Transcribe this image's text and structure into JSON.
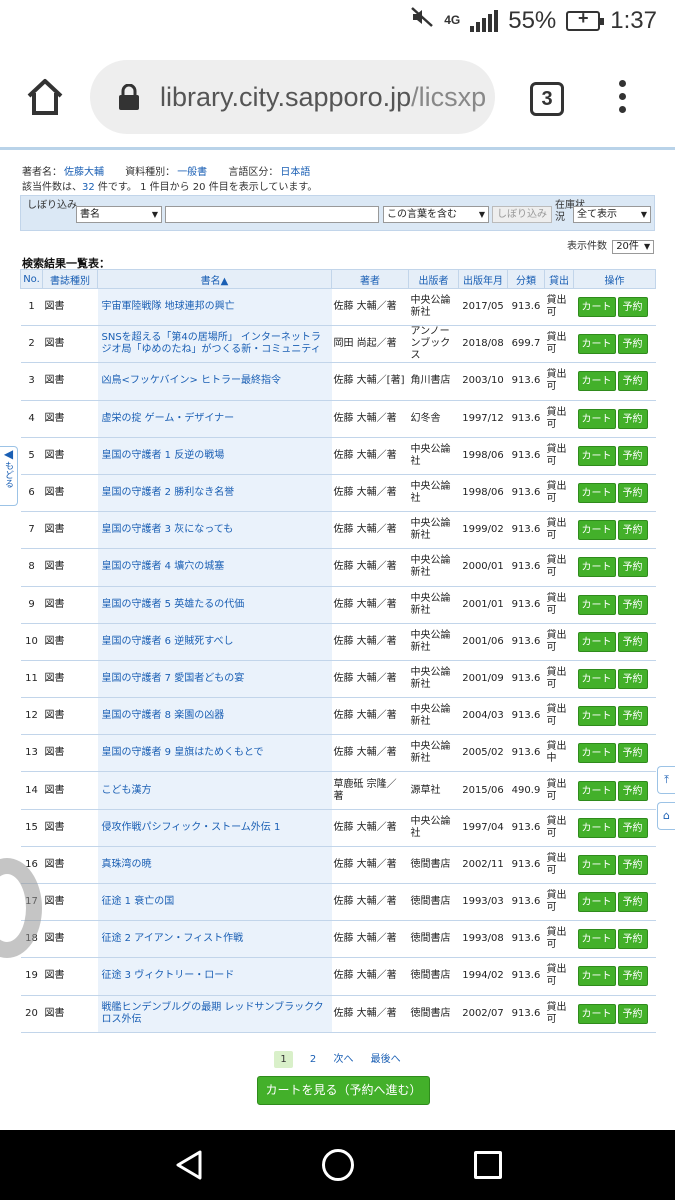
{
  "status_bar": {
    "network": "4G",
    "battery_percent": "55%",
    "time": "1:37"
  },
  "browser": {
    "url_main": "library.city.sapporo.jp",
    "url_rest": "/licsxp",
    "tab_count": "3"
  },
  "search_conditions": {
    "author_label": "著者名：",
    "author_value": "佐藤大輔",
    "type_label": "資料種別：",
    "type_value": "一般書",
    "lang_label": "言語区分：",
    "lang_value": "日本語"
  },
  "summary": {
    "pre": "該当件数は、",
    "count": "32",
    "mid": " 件です。 1 件目から 20 件目を表示しています。"
  },
  "filter": {
    "label": "しぼり込み",
    "field_select": "書名",
    "text_value": "",
    "mode_select": "この言葉を含む",
    "button_label": "しぼり込み",
    "stock_label": "在庫状況",
    "stock_select": "全て表示"
  },
  "display_count": {
    "label": "表示件数",
    "value": "20件"
  },
  "list_title": "検索結果一覧表：",
  "table": {
    "headers": [
      "No.",
      "書誌種別",
      "書名▲",
      "著者",
      "出版者",
      "出版年月",
      "分類",
      "貸出",
      "操作"
    ],
    "cart_label": "カート",
    "reserve_label": "予約",
    "rows": [
      {
        "no": "1",
        "kind": "図書",
        "title": "宇宙軍陸戦隊 地球連邦の興亡",
        "author": "佐藤 大輔／著",
        "publisher": "中央公論新社",
        "year": "2017/05",
        "cls": "913.6",
        "lend": "貸出可"
      },
      {
        "no": "2",
        "kind": "図書",
        "title": "SNSを超える「第4の居場所」 インターネットラジオ局「ゆめのたね」がつくる新・コミュニティ",
        "author": "岡田 尚起／著",
        "publisher": "アンノーンブックス",
        "year": "2018/08",
        "cls": "699.7",
        "lend": "貸出可"
      },
      {
        "no": "3",
        "kind": "図書",
        "title": "凶鳥<フッケバイン> ヒトラー最終指令",
        "author": "佐藤 大輔／[著]",
        "publisher": "角川書店",
        "year": "2003/10",
        "cls": "913.6",
        "lend": "貸出可"
      },
      {
        "no": "4",
        "kind": "図書",
        "title": "虚栄の掟 ゲーム・デザイナー",
        "author": "佐藤 大輔／著",
        "publisher": "幻冬舎",
        "year": "1997/12",
        "cls": "913.6",
        "lend": "貸出可"
      },
      {
        "no": "5",
        "kind": "図書",
        "title": "皇国の守護者 1 反逆の戦場",
        "author": "佐藤 大輔／著",
        "publisher": "中央公論社",
        "year": "1998/06",
        "cls": "913.6",
        "lend": "貸出可"
      },
      {
        "no": "6",
        "kind": "図書",
        "title": "皇国の守護者 2 勝利なき名誉",
        "author": "佐藤 大輔／著",
        "publisher": "中央公論社",
        "year": "1998/06",
        "cls": "913.6",
        "lend": "貸出可"
      },
      {
        "no": "7",
        "kind": "図書",
        "title": "皇国の守護者 3 灰になっても",
        "author": "佐藤 大輔／著",
        "publisher": "中央公論新社",
        "year": "1999/02",
        "cls": "913.6",
        "lend": "貸出可"
      },
      {
        "no": "8",
        "kind": "図書",
        "title": "皇国の守護者 4 壙穴の城塞",
        "author": "佐藤 大輔／著",
        "publisher": "中央公論新社",
        "year": "2000/01",
        "cls": "913.6",
        "lend": "貸出可"
      },
      {
        "no": "9",
        "kind": "図書",
        "title": "皇国の守護者 5 英雄たるの代価",
        "author": "佐藤 大輔／著",
        "publisher": "中央公論新社",
        "year": "2001/01",
        "cls": "913.6",
        "lend": "貸出可"
      },
      {
        "no": "10",
        "kind": "図書",
        "title": "皇国の守護者 6 逆賊死すべし",
        "author": "佐藤 大輔／著",
        "publisher": "中央公論新社",
        "year": "2001/06",
        "cls": "913.6",
        "lend": "貸出可"
      },
      {
        "no": "11",
        "kind": "図書",
        "title": "皇国の守護者 7 愛国者どもの宴",
        "author": "佐藤 大輔／著",
        "publisher": "中央公論新社",
        "year": "2001/09",
        "cls": "913.6",
        "lend": "貸出可"
      },
      {
        "no": "12",
        "kind": "図書",
        "title": "皇国の守護者 8 楽園の凶器",
        "author": "佐藤 大輔／著",
        "publisher": "中央公論新社",
        "year": "2004/03",
        "cls": "913.6",
        "lend": "貸出可"
      },
      {
        "no": "13",
        "kind": "図書",
        "title": "皇国の守護者 9 皇旗はためくもとで",
        "author": "佐藤 大輔／著",
        "publisher": "中央公論新社",
        "year": "2005/02",
        "cls": "913.6",
        "lend": "貸出中"
      },
      {
        "no": "14",
        "kind": "図書",
        "title": "こども漢方",
        "author": "草鹿砥 宗隆／著",
        "publisher": "源草社",
        "year": "2015/06",
        "cls": "490.9",
        "lend": "貸出可"
      },
      {
        "no": "15",
        "kind": "図書",
        "title": "侵攻作戦パシフィック・ストーム外伝 1",
        "author": "佐藤 大輔／著",
        "publisher": "中央公論社",
        "year": "1997/04",
        "cls": "913.6",
        "lend": "貸出可"
      },
      {
        "no": "16",
        "kind": "図書",
        "title": "真珠湾の暁",
        "author": "佐藤 大輔／著",
        "publisher": "徳間書店",
        "year": "2002/11",
        "cls": "913.6",
        "lend": "貸出可"
      },
      {
        "no": "17",
        "kind": "図書",
        "title": "征途 1 衰亡の国",
        "author": "佐藤 大輔／著",
        "publisher": "徳間書店",
        "year": "1993/03",
        "cls": "913.6",
        "lend": "貸出可"
      },
      {
        "no": "18",
        "kind": "図書",
        "title": "征途 2 アイアン・フィスト作戦",
        "author": "佐藤 大輔／著",
        "publisher": "徳間書店",
        "year": "1993/08",
        "cls": "913.6",
        "lend": "貸出可"
      },
      {
        "no": "19",
        "kind": "図書",
        "title": "征途 3 ヴィクトリー・ロード",
        "author": "佐藤 大輔／著",
        "publisher": "徳間書店",
        "year": "1994/02",
        "cls": "913.6",
        "lend": "貸出可"
      },
      {
        "no": "20",
        "kind": "図書",
        "title": "戦艦ヒンデンブルグの最期 レッドサンブラッククロス外伝",
        "author": "佐藤 大輔／著",
        "publisher": "徳間書店",
        "year": "2002/07",
        "cls": "913.6",
        "lend": "貸出可"
      }
    ]
  },
  "pager": {
    "page1": "1",
    "page2": "2",
    "next": "次へ",
    "last": "最後へ"
  },
  "view_cart_button": "カートを見る（予約へ進む）",
  "side_tab": {
    "label": "もどる"
  },
  "colors": {
    "accent_blue": "#1a5fb4",
    "green_button": "#43b02a",
    "panel_blue": "#dbe8f5"
  }
}
